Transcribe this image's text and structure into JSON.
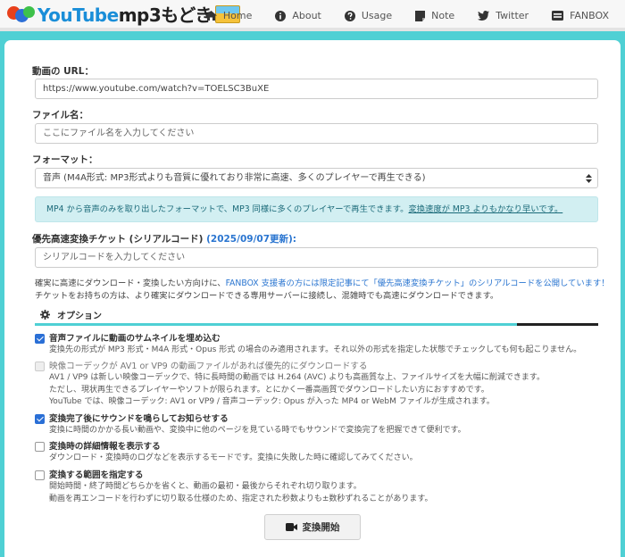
{
  "logo": {
    "text_blue": "YouTube",
    "text_dark": "mp3もどき"
  },
  "nav": [
    "Home",
    "About",
    "Usage",
    "Note",
    "Twitter",
    "FANBOX"
  ],
  "url": {
    "label": "動画の URL：",
    "value": "https://www.youtube.com/watch?v=TOELSC3BuXE"
  },
  "filename": {
    "label": "ファイル名：",
    "placeholder": "ここにファイル名を入力してください"
  },
  "format": {
    "label": "フォーマット：",
    "selected": "音声 (M4A形式: MP3形式よりも音質に優れており非常に高速、多くのプレイヤーで再生できる)",
    "info": "MP4 から音声のみを取り出したフォーマットで、MP3 同様に多くのプレイヤーで再生できます。",
    "info_link": "変換速度が MP3 よりもかなり早いです。"
  },
  "ticket": {
    "label": "優先高速変換チケット (シリアルコード)",
    "label_date": "(2025/09/07更新):",
    "placeholder": "シリアルコードを入力してください",
    "note1_a": "確実に高速にダウンロード・変換したい方向けに、",
    "note1_b": "FANBOX 支援者の方には限定記事にて「優先高速変換チケット」のシリアルコードを公開しています！",
    "note2": "チケットをお持ちの方は、より確実にダウンロードできる専用サーバーに接続し、混雑時でも高速にダウンロードできます。"
  },
  "options": {
    "title": "オプション",
    "items": [
      {
        "title": "音声ファイルに動画のサムネイルを埋め込む",
        "checked": true,
        "disabled": false,
        "desc": [
          "変換先の形式が MP3 形式・M4A 形式・Opus 形式 の場合のみ適用されます。それ以外の形式を指定した状態でチェックしても何も起こりません。"
        ]
      },
      {
        "title": "映像コーデックが AV1 or VP9 の動画ファイルがあれば優先的にダウンロードする",
        "checked": false,
        "disabled": true,
        "desc": [
          "AV1 / VP9 は新しい映像コーデックで、特に長時間の動画では H.264 (AVC) よりも高画質な上、ファイルサイズを大幅に削減できます。",
          "ただし、現状再生できるプレイヤーやソフトが限られます。とにかく一番高画質でダウンロードしたい方におすすめです。",
          "YouTube では、映像コーデック: AV1 or VP9 / 音声コーデック: Opus が入った MP4 or WebM ファイルが生成されます。"
        ]
      },
      {
        "title": "変換完了後にサウンドを鳴らしてお知らせする",
        "checked": true,
        "disabled": false,
        "desc": [
          "変換に時間のかかる長い動画や、変換中に他のページを見ている時でもサウンドで変換完了を把握できて便利です。"
        ]
      },
      {
        "title": "変換時の詳細情報を表示する",
        "checked": false,
        "disabled": false,
        "desc": [
          "ダウンロード・変換時のログなどを表示するモードです。変換に失敗した時に確認してみてください。"
        ]
      },
      {
        "title": "変換する範囲を指定する",
        "checked": false,
        "disabled": false,
        "desc": [
          "開始時間・終了時間どちらかを省くと、動画の最初・最後からそれぞれ切り取ります。",
          "動画を再エンコードを行わずに切り取る仕様のため、指定された秒数よりも±数秒ずれることがあります。"
        ]
      }
    ]
  },
  "submit": "変換開始",
  "colors": {
    "accent": "#4fd0d4",
    "link": "#2a75d0",
    "checkbox": "#2a6fd6"
  }
}
